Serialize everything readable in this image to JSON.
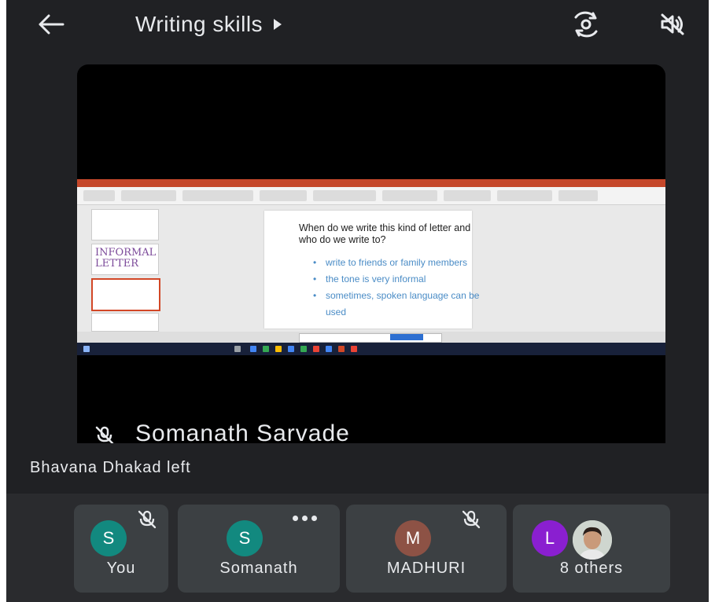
{
  "header": {
    "back_icon": "back-arrow-icon",
    "title": "Writing skills",
    "title_arrow_icon": "play-arrow-icon",
    "flip_camera_icon": "flip-camera-icon",
    "speaker_icon": "speaker-off-icon"
  },
  "stage": {
    "presenter_name": "Somanath Sarvade",
    "presenter_mic_icon": "mic-off-icon",
    "slide": {
      "question": "When do we write this kind of letter and who do we write to?",
      "bullets": [
        "write to friends or family members",
        "the tone is very informal",
        "sometimes, spoken language can be used"
      ],
      "thumbnail_title": "INFORMAL LETTER"
    }
  },
  "notice": "Bhavana Dhakad left",
  "participants": [
    {
      "initial": "S",
      "label": "You",
      "color": "#12897f",
      "status_icon": "mic-off-icon"
    },
    {
      "initial": "S",
      "label": "Somanath",
      "color": "#12897f",
      "status_icon": "more-options-icon"
    },
    {
      "initial": "M",
      "label": "MADHURI",
      "color": "#8d5245",
      "status_icon": "mic-off-icon"
    },
    {
      "initial": "L",
      "label": "8 others",
      "color": "#8a1fd0",
      "status_icon": "participant-photo"
    }
  ]
}
